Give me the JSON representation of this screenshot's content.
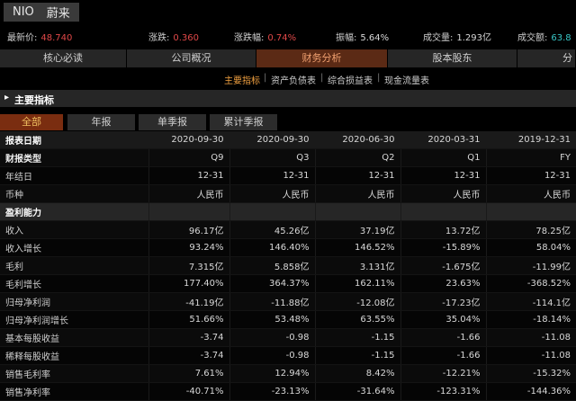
{
  "header": {
    "ticker": "NIO",
    "name": "蔚来"
  },
  "quote": [
    {
      "label": "最新价:",
      "value": "48.740",
      "color": "red"
    },
    {
      "label": "涨跌:",
      "value": "0.360",
      "color": "red"
    },
    {
      "label": "涨跌幅:",
      "value": "0.74%",
      "color": "red"
    },
    {
      "label": "振幅:",
      "value": "5.64%",
      "color": "wht"
    },
    {
      "label": "成交量:",
      "value": "1.293亿",
      "color": "wht"
    },
    {
      "label": "成交额:",
      "value": "63.8",
      "color": "cyan"
    }
  ],
  "main_tabs": [
    "核心必读",
    "公司概况",
    "财务分析",
    "股本股东",
    "分红"
  ],
  "main_tabs_active": 2,
  "sub_tabs": [
    "主要指标",
    "资产负债表",
    "综合损益表",
    "现金流量表"
  ],
  "section_title": "主要指标",
  "filter_tabs": [
    "全部",
    "年报",
    "单季报",
    "累计季报"
  ],
  "table": {
    "head": {
      "label": "报表日期",
      "cols": [
        "2020-09-30",
        "2020-09-30",
        "2020-06-30",
        "2020-03-31",
        "2019-12-31"
      ]
    },
    "rows": [
      {
        "type": "bold",
        "label": "财报类型",
        "cols": [
          "Q9",
          "Q3",
          "Q2",
          "Q1",
          "FY"
        ]
      },
      {
        "type": "row",
        "label": "年结日",
        "cols": [
          "12-31",
          "12-31",
          "12-31",
          "12-31",
          "12-31"
        ]
      },
      {
        "type": "row",
        "label": "币种",
        "cols": [
          "人民币",
          "人民币",
          "人民币",
          "人民币",
          "人民币"
        ]
      },
      {
        "type": "sec",
        "label": "盈利能力",
        "cols": [
          "",
          "",
          "",
          "",
          ""
        ]
      },
      {
        "type": "row",
        "label": "收入",
        "cols": [
          "96.17亿",
          "45.26亿",
          "37.19亿",
          "13.72亿",
          "78.25亿"
        ]
      },
      {
        "type": "row",
        "label": "收入增长",
        "cols": [
          "93.24%",
          "146.40%",
          "146.52%",
          "-15.89%",
          "58.04%"
        ]
      },
      {
        "type": "row",
        "label": "毛利",
        "cols": [
          "7.315亿",
          "5.858亿",
          "3.131亿",
          "-1.675亿",
          "-11.99亿"
        ]
      },
      {
        "type": "row",
        "label": "毛利增长",
        "cols": [
          "177.40%",
          "364.37%",
          "162.11%",
          "23.63%",
          "-368.52%"
        ]
      },
      {
        "type": "row",
        "label": "归母净利润",
        "cols": [
          "-41.19亿",
          "-11.88亿",
          "-12.08亿",
          "-17.23亿",
          "-114.1亿"
        ]
      },
      {
        "type": "row",
        "label": "归母净利润增长",
        "cols": [
          "51.66%",
          "53.48%",
          "63.55%",
          "35.04%",
          "-18.14%"
        ]
      },
      {
        "type": "row",
        "label": "基本每股收益",
        "cols": [
          "-3.74",
          "-0.98",
          "-1.15",
          "-1.66",
          "-11.08"
        ]
      },
      {
        "type": "row",
        "label": "稀释每股收益",
        "cols": [
          "-3.74",
          "-0.98",
          "-1.15",
          "-1.66",
          "-11.08"
        ]
      },
      {
        "type": "row",
        "label": "销售毛利率",
        "cols": [
          "7.61%",
          "12.94%",
          "8.42%",
          "-12.21%",
          "-15.32%"
        ]
      },
      {
        "type": "row",
        "label": "销售净利率",
        "cols": [
          "-40.71%",
          "-23.13%",
          "-31.64%",
          "-123.31%",
          "-144.36%"
        ]
      }
    ]
  }
}
